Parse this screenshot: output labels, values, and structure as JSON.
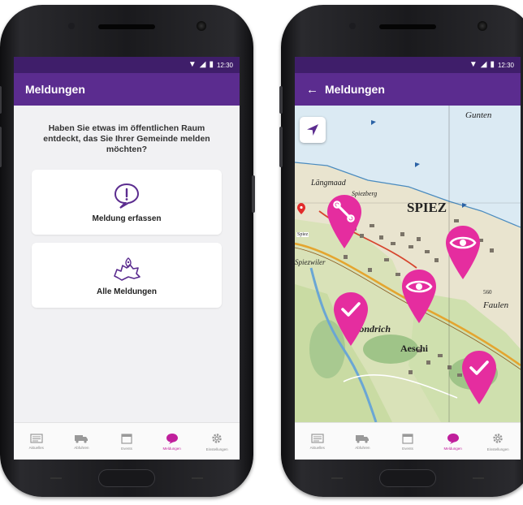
{
  "colors": {
    "statusbar": "#3f1e6a",
    "appbar": "#5b2c8f",
    "accent": "#c01f9c",
    "pin": "#e52d9f"
  },
  "left_phone": {
    "statusbar": {
      "time": "12:30"
    },
    "appbar": {
      "title": "Meldungen"
    },
    "prompt": "Haben Sie etwas im öffentlichen Raum entdeckt, das Sie Ihrer Gemeinde melden möchten?",
    "cards": [
      {
        "label": "Meldung erfassen",
        "icon": "speech-exclamation-icon"
      },
      {
        "label": "Alle Meldungen",
        "icon": "municipality-map-icon"
      }
    ]
  },
  "right_phone": {
    "statusbar": {
      "time": "12:30"
    },
    "appbar": {
      "title": "Meldungen"
    },
    "map": {
      "labels": [
        "SPIEZ",
        "Gunten",
        "Längmaad",
        "Spiezberg",
        "Spiezwiler",
        "Hondrich",
        "Aeschi",
        "Faulen",
        "560",
        "Spiez"
      ],
      "pins": [
        "wrench-pin",
        "eye-pin",
        "eye-pin",
        "check-pin",
        "check-pin"
      ]
    }
  },
  "bottom_nav": [
    {
      "label": "Aktuelles",
      "icon": "news-icon"
    },
    {
      "label": "Abfuhren",
      "icon": "truck-icon"
    },
    {
      "label": "Events",
      "icon": "calendar-icon"
    },
    {
      "label": "Meldungen",
      "icon": "chat-bubble-icon",
      "active": true
    },
    {
      "label": "Einstellungen",
      "icon": "gear-icon"
    }
  ]
}
